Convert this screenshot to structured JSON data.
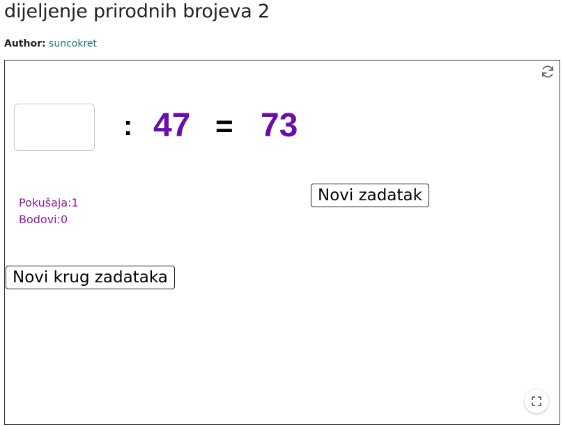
{
  "page": {
    "title": "dijeljenje prirodnih brojeva 2",
    "author_label": "Author:",
    "author_name": "suncokret"
  },
  "applet": {
    "answer_value": "",
    "colon_symbol": ":",
    "divisor": "47",
    "equals_symbol": "=",
    "quotient": "73",
    "attempts_text": "Pokušaja:1",
    "points_text": "Bodovi:0",
    "new_task_label": "Novi zadatak",
    "new_round_label": "Novi krug zadataka",
    "icons": [
      "refresh-icon",
      "fullscreen-icon"
    ],
    "colors": {
      "number_purple": "#6a0dad",
      "stat_text": "#8b1a9e",
      "author_link": "#1a7a6e"
    }
  }
}
